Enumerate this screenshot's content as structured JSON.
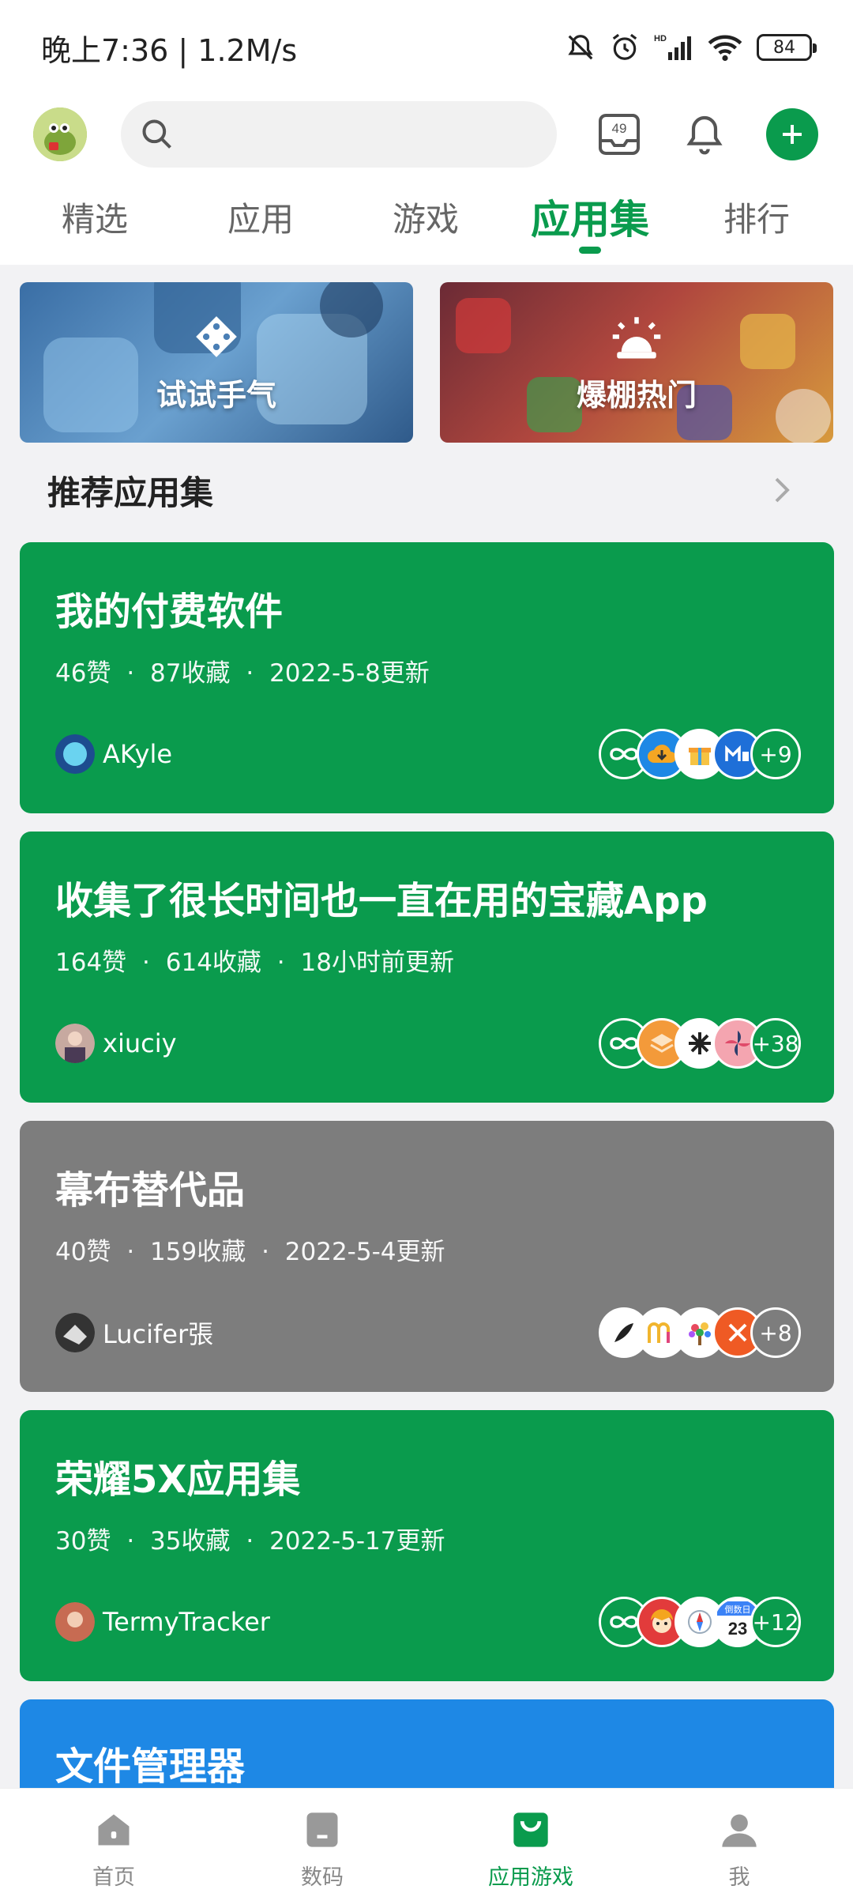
{
  "status": {
    "time": "晚上7:36 | 1.2M/s",
    "battery": "84",
    "signal_label": "HD"
  },
  "header": {
    "search_placeholder": "",
    "inbox_badge": "49"
  },
  "tabs": [
    {
      "label": "精选"
    },
    {
      "label": "应用"
    },
    {
      "label": "游戏"
    },
    {
      "label": "应用集"
    },
    {
      "label": "排行"
    }
  ],
  "active_tab": "应用集",
  "banners": [
    {
      "label": "试试手气",
      "icon": "dice-icon"
    },
    {
      "label": "爆棚热门",
      "icon": "alarm-bell-icon"
    }
  ],
  "section": {
    "title": "推荐应用集"
  },
  "collections": [
    {
      "title": "我的付费软件",
      "likes": "46赞",
      "favorites": "87收藏",
      "updated": "2022-5-8更新",
      "author": "AKyle",
      "more": "+9",
      "color": "#0a9b4d"
    },
    {
      "title": "收集了很长时间也一直在用的宝藏App",
      "likes": "164赞",
      "favorites": "614收藏",
      "updated": "18小时前更新",
      "author": "xiuciy",
      "more": "+38",
      "color": "#0a9b4d"
    },
    {
      "title": "幕布替代品",
      "likes": "40赞",
      "favorites": "159收藏",
      "updated": "2022-5-4更新",
      "author": "Lucifer張",
      "more": "+8",
      "color": "#7d7d7d"
    },
    {
      "title": "荣耀5X应用集",
      "likes": "30赞",
      "favorites": "35收藏",
      "updated": "2022-5-17更新",
      "author": "TermyTracker",
      "more": "+12",
      "color": "#0a9b4d"
    },
    {
      "title": "文件管理器",
      "color": "#1e88e5"
    }
  ],
  "calendar_icon": {
    "top": "倒数日",
    "day": "23"
  },
  "stats_separator": "·",
  "bottom_nav": [
    {
      "label": "首页",
      "icon": "home-icon"
    },
    {
      "label": "数码",
      "icon": "device-icon"
    },
    {
      "label": "应用游戏",
      "icon": "shopping-bag-icon"
    },
    {
      "label": "我",
      "icon": "profile-icon"
    }
  ],
  "colors": {
    "accent": "#0a9b4d",
    "gray_card": "#7d7d7d",
    "blue_card": "#1e88e5"
  }
}
